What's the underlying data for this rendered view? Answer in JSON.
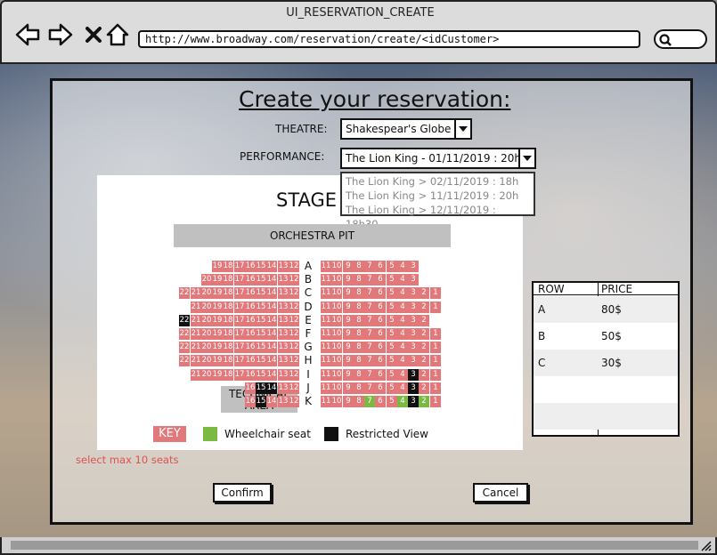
{
  "window": {
    "title": "UI_RESERVATION_CREATE",
    "url": "http://www.broadway.com/reservation/create/<idCustomer>"
  },
  "form": {
    "title": "Create your reservation:",
    "theatre_label": "THEATRE:",
    "theatre_value": "Shakespear's Globe",
    "performance_label": "PERFORMANCE:",
    "performance_value": "The Lion King - 01/11/2019 : 20h",
    "performance_options": [
      "The Lion King > 02/11/2019 : 18h",
      "The Lion King > 11/11/2019 : 20h",
      "The Lion King > 12/11/2019 : 18h30"
    ]
  },
  "seating": {
    "stage": "STAGE",
    "orchestra_pit": "ORCHESTRA PIT",
    "technical_area": "TECHNICAL AREA",
    "rows": [
      {
        "label": "A",
        "left": [
          "19",
          "18",
          "17",
          "16",
          "15",
          "14",
          "13",
          "12"
        ],
        "right": [
          "11",
          "10",
          "9",
          "8",
          "7",
          "6",
          "5",
          "4",
          "3"
        ]
      },
      {
        "label": "B",
        "left": [
          "20",
          "19",
          "18",
          "17",
          "16",
          "15",
          "14",
          "13",
          "12"
        ],
        "right": [
          "11",
          "10",
          "9",
          "8",
          "7",
          "6",
          "5",
          "4",
          "3"
        ]
      },
      {
        "label": "C",
        "left": [
          "22",
          "21",
          "20",
          "19",
          "18",
          "17",
          "16",
          "15",
          "14",
          "13",
          "12"
        ],
        "right": [
          "11",
          "10",
          "9",
          "8",
          "7",
          "6",
          "5",
          "4",
          "3",
          "2",
          "1"
        ]
      },
      {
        "label": "D",
        "left": [
          "21",
          "20",
          "19",
          "18",
          "17",
          "16",
          "15",
          "14",
          "13",
          "12"
        ],
        "right": [
          "11",
          "10",
          "9",
          "8",
          "7",
          "6",
          "5",
          "4",
          "3",
          "2",
          "1"
        ]
      },
      {
        "label": "E",
        "left": [
          "22",
          "21",
          "20",
          "19",
          "18",
          "17",
          "16",
          "15",
          "14",
          "13",
          "12"
        ],
        "right": [
          "11",
          "10",
          "9",
          "8",
          "7",
          "6",
          "5",
          "4",
          "3",
          "2"
        ]
      },
      {
        "label": "F",
        "left": [
          "22",
          "21",
          "20",
          "19",
          "18",
          "17",
          "16",
          "15",
          "14",
          "13",
          "12"
        ],
        "right": [
          "11",
          "10",
          "9",
          "8",
          "7",
          "6",
          "5",
          "4",
          "3",
          "2",
          "1"
        ]
      },
      {
        "label": "G",
        "left": [
          "22",
          "21",
          "20",
          "19",
          "18",
          "17",
          "16",
          "15",
          "14",
          "13",
          "12"
        ],
        "right": [
          "11",
          "10",
          "9",
          "8",
          "7",
          "6",
          "5",
          "4",
          "3",
          "2",
          "1"
        ]
      },
      {
        "label": "H",
        "left": [
          "22",
          "21",
          "20",
          "19",
          "18",
          "17",
          "16",
          "15",
          "14",
          "13",
          "12"
        ],
        "right": [
          "11",
          "10",
          "9",
          "8",
          "7",
          "6",
          "5",
          "4",
          "3",
          "2",
          "1"
        ]
      },
      {
        "label": "I",
        "left": [
          "21",
          "20",
          "19",
          "18",
          "17",
          "16",
          "15",
          "14",
          "13",
          "12"
        ],
        "right": [
          "11",
          "10",
          "9",
          "8",
          "7",
          "6",
          "5",
          "4",
          "3",
          "2",
          "1"
        ]
      },
      {
        "label": "J",
        "left": [
          "16",
          "15",
          "14",
          "13",
          "12"
        ],
        "right": [
          "11",
          "10",
          "9",
          "8",
          "7",
          "6",
          "5",
          "4",
          "3",
          "2",
          "1"
        ]
      },
      {
        "label": "K",
        "left": [
          "16",
          "15",
          "14",
          "13",
          "12"
        ],
        "right": [
          "11",
          "10",
          "9",
          "8",
          "7",
          "6",
          "5",
          "4",
          "3",
          "2",
          "1"
        ]
      }
    ],
    "restricted": [
      "E22",
      "J15",
      "J14",
      "K15",
      "I3",
      "J3",
      "K3"
    ],
    "wheelchair": [
      "K7",
      "K4",
      "K2"
    ]
  },
  "key": {
    "label": "KEY",
    "wheelchair": "Wheelchair seat",
    "restricted": "Restricted View",
    "wheelchair_color": "#7cb943",
    "restricted_color": "#111111",
    "seat_color": "#e3787a"
  },
  "prices": {
    "header_row": "ROW",
    "header_price": "PRICE",
    "rows": [
      {
        "row": "A",
        "price": "80$"
      },
      {
        "row": "B",
        "price": "50$"
      },
      {
        "row": "C",
        "price": "30$"
      },
      {
        "row": "",
        "price": ""
      },
      {
        "row": "",
        "price": ""
      }
    ]
  },
  "hint": "select max 10 seats",
  "buttons": {
    "confirm": "Confirm",
    "cancel": "Cancel"
  }
}
